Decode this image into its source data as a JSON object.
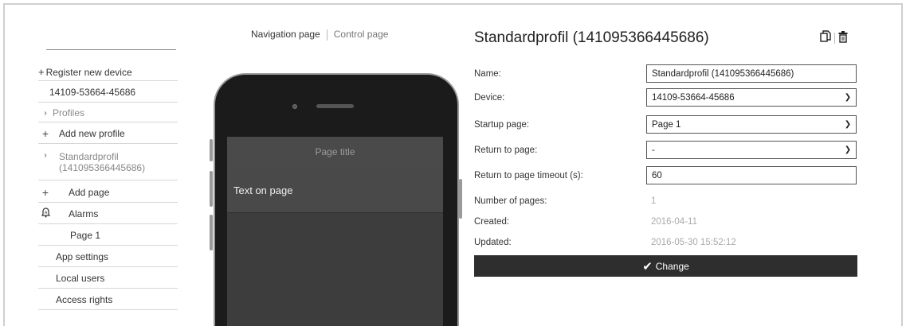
{
  "sidebar": {
    "items": [
      {
        "mark": "+",
        "label": "Register new device"
      },
      {
        "mark": "",
        "label": "14109-53664-45686"
      },
      {
        "mark": "›",
        "label": "Profiles"
      },
      {
        "mark": "+",
        "label": "Add new profile"
      },
      {
        "mark": "›",
        "label": "Standardprofil\n(141095366445686)"
      },
      {
        "mark": "+",
        "label": "Add page"
      },
      {
        "mark": "",
        "label": "Alarms"
      },
      {
        "mark": "",
        "label": "Page 1"
      },
      {
        "mark": "",
        "label": "App settings"
      },
      {
        "mark": "",
        "label": "Local users"
      },
      {
        "mark": "",
        "label": "Access rights"
      }
    ]
  },
  "nav": {
    "navigation_page": "Navigation page",
    "control_page": "Control page"
  },
  "phone": {
    "page_title": "Page title",
    "text_on_page": "Text on page"
  },
  "profile": {
    "title": "Standardprofil (141095366445686)",
    "icons": [
      "copy-icon",
      "trash-icon"
    ],
    "fields": {
      "name_label": "Name:",
      "name_value": "Standardprofil (141095366445686)",
      "device_label": "Device:",
      "device_value": "14109-53664-45686",
      "startup_label": "Startup page:",
      "startup_value": "Page 1",
      "return_label": "Return to page:",
      "return_value": "-",
      "timeout_label": "Return to page timeout (s):",
      "timeout_value": "60",
      "pages_label": "Number of pages:",
      "pages_value": "1",
      "created_label": "Created:",
      "created_value": "2016-04-11",
      "updated_label": "Updated:",
      "updated_value": "2016-05-30 15:52:12"
    },
    "change_label": "Change"
  }
}
